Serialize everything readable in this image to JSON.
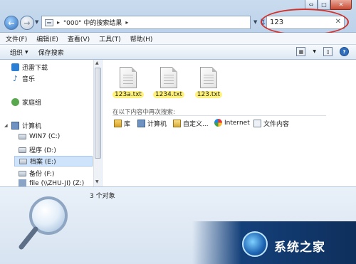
{
  "window": {
    "buttons": {
      "minimize": "⇔",
      "maximize": "□",
      "close": "✕"
    }
  },
  "address": {
    "breadcrumb": "\"000\" 中的搜索结果",
    "separator": "▸"
  },
  "search": {
    "value": "123",
    "clear": "✕"
  },
  "menu": [
    "文件(F)",
    "编辑(E)",
    "查看(V)",
    "工具(T)",
    "帮助(H)"
  ],
  "toolbar": {
    "organize": "组织",
    "save_search": "保存搜索"
  },
  "nav": {
    "favorites": [
      {
        "label": "迅雷下载",
        "icon": "download-folder-icon"
      },
      {
        "label": "音乐",
        "icon": "music-icon"
      }
    ],
    "homegroup": "家庭组",
    "computer": "计算机",
    "drives": [
      {
        "label": "WIN7 (C:)"
      },
      {
        "label": "程序 (D:)"
      },
      {
        "label": "档案 (E:)"
      },
      {
        "label": "备份 (F:)"
      },
      {
        "label": "file (\\\\ZHU-JI) (Z:)"
      }
    ]
  },
  "results": [
    {
      "name": "123a.txt"
    },
    {
      "name": "1234.txt"
    },
    {
      "name": "123.txt"
    }
  ],
  "search_again": {
    "title": "在以下内容中再次搜索:",
    "locations": [
      {
        "label": "库",
        "icon": "library-icon"
      },
      {
        "label": "计算机",
        "icon": "computer-icon"
      },
      {
        "label": "自定义...",
        "icon": "custom-folder-icon"
      },
      {
        "label": "Internet",
        "icon": "internet-icon"
      },
      {
        "label": "文件内容",
        "icon": "file-contents-icon"
      }
    ]
  },
  "status": {
    "count": "3 个对象"
  },
  "watermark": {
    "text": "系统之家"
  },
  "colors": {
    "highlight_circle": "#d2322b",
    "file_highlight": "#fff27a"
  }
}
